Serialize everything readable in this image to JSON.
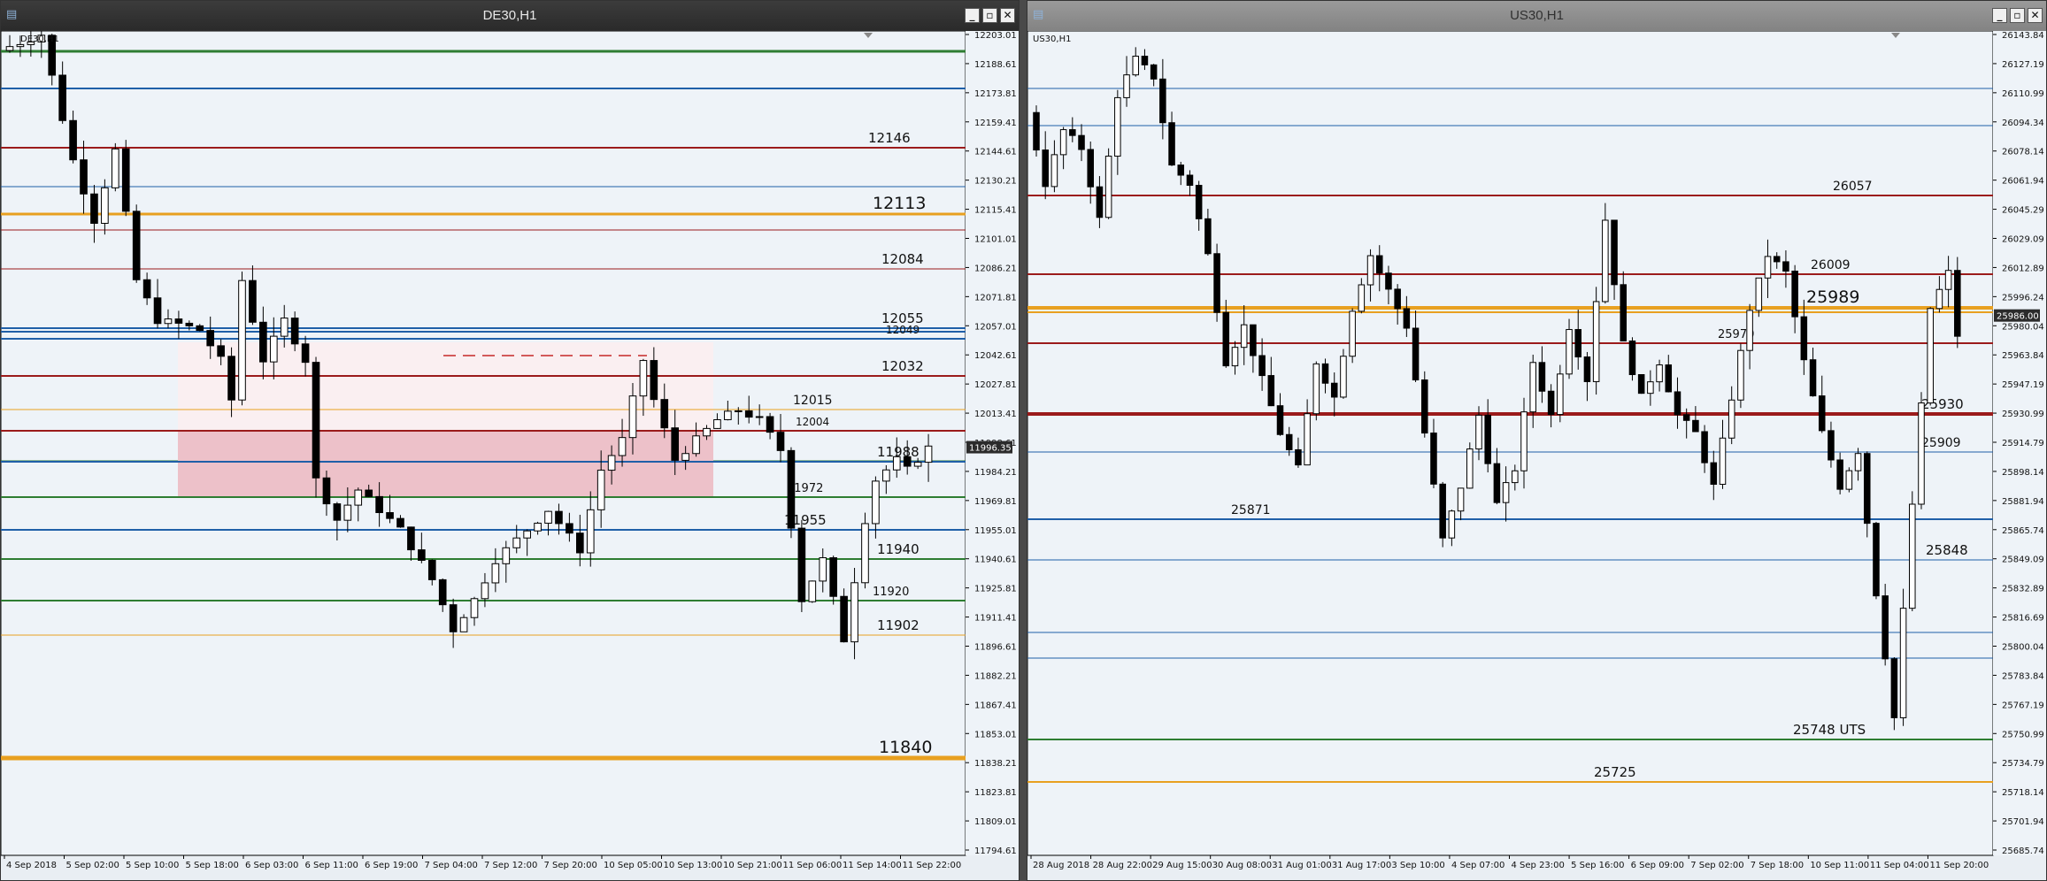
{
  "windows": [
    {
      "title": "DE30,H1",
      "symbol_label": "DE30,H1",
      "price_ticks": [
        "12203.01",
        "12188.61",
        "12173.81",
        "12159.41",
        "12144.61",
        "12130.21",
        "12115.41",
        "12101.01",
        "12086.21",
        "12071.81",
        "12057.01",
        "12042.61",
        "12027.81",
        "12013.41",
        "11998.61",
        "11984.21",
        "11969.81",
        "11955.01",
        "11940.61",
        "11925.81",
        "11911.41",
        "11896.61",
        "11882.21",
        "11867.41",
        "11853.01",
        "11838.21",
        "11823.81",
        "11809.01",
        "11794.61"
      ],
      "current_price": "11996.35",
      "time_ticks": [
        "4 Sep 2018",
        "5 Sep 02:00",
        "5 Sep 10:00",
        "5 Sep 18:00",
        "6 Sep 03:00",
        "6 Sep 11:00",
        "6 Sep 19:00",
        "7 Sep 04:00",
        "7 Sep 12:00",
        "7 Sep 20:00",
        "10 Sep 05:00",
        "10 Sep 13:00",
        "10 Sep 21:00",
        "11 Sep 06:00",
        "11 Sep 14:00",
        "11 Sep 22:00"
      ],
      "levels": [
        {
          "label": "12146",
          "color": "#9b1b1b"
        },
        {
          "label": "12113",
          "color": "#e8a020"
        },
        {
          "label": "12084",
          "color": "#9b1b1b"
        },
        {
          "label": "12055",
          "color": "#1f5fa8"
        },
        {
          "label": "12049",
          "color": "#1f5fa8"
        },
        {
          "label": "12032",
          "color": "#9b1b1b"
        },
        {
          "label": "12015",
          "color": "#e8a020"
        },
        {
          "label": "12004",
          "color": "#9b1b1b"
        },
        {
          "label": "11988",
          "color": "#1f5fa8"
        },
        {
          "label": "11972",
          "color": "#2e7d32"
        },
        {
          "label": "11955",
          "color": "#1f5fa8"
        },
        {
          "label": "11940",
          "color": "#2e7d32"
        },
        {
          "label": "11920",
          "color": "#2e7d32"
        },
        {
          "label": "11902",
          "color": "#e8a020"
        },
        {
          "label": "11840",
          "color": "#e8a020"
        }
      ]
    },
    {
      "title": "US30,H1",
      "symbol_label": "US30,H1",
      "price_ticks": [
        "26143.84",
        "26127.19",
        "26110.99",
        "26094.34",
        "26078.14",
        "26061.94",
        "26045.29",
        "26029.09",
        "26012.89",
        "25996.24",
        "25980.04",
        "25963.84",
        "25947.19",
        "25930.99",
        "25914.79",
        "25898.14",
        "25881.94",
        "25865.74",
        "25849.09",
        "25832.89",
        "25816.69",
        "25800.04",
        "25783.84",
        "25767.19",
        "25750.99",
        "25734.79",
        "25718.14",
        "25701.94",
        "25685.74"
      ],
      "current_price": "25986.00",
      "time_ticks": [
        "28 Aug 2018",
        "28 Aug 22:00",
        "29 Aug 15:00",
        "30 Aug 08:00",
        "31 Aug 01:00",
        "31 Aug 17:00",
        "3 Sep 10:00",
        "4 Sep 07:00",
        "4 Sep 23:00",
        "5 Sep 16:00",
        "6 Sep 09:00",
        "7 Sep 02:00",
        "7 Sep 18:00",
        "10 Sep 11:00",
        "11 Sep 04:00",
        "11 Sep 20:00"
      ],
      "levels": [
        {
          "label": "26057",
          "color": "#9b1b1b"
        },
        {
          "label": "26009",
          "color": "#9b1b1b"
        },
        {
          "label": "25989",
          "color": "#e8a020"
        },
        {
          "label": "25970",
          "color": "#9b1b1b"
        },
        {
          "label": "25930",
          "color": "#9b1b1b"
        },
        {
          "label": "25909",
          "color": "#1f5fa8"
        },
        {
          "label": "25871",
          "color": "#1f5fa8"
        },
        {
          "label": "25848",
          "color": "#1f5fa8"
        },
        {
          "label": "25748 UTS",
          "color": "#2e7d32"
        },
        {
          "label": "25725",
          "color": "#e8a020"
        }
      ]
    }
  ],
  "chart_data": [
    {
      "type": "candlestick",
      "title": "DE30,H1",
      "ylim": [
        11794.61,
        12203.01
      ],
      "x_ticks": [
        "4 Sep 2018",
        "5 Sep 02:00",
        "5 Sep 10:00",
        "5 Sep 18:00",
        "6 Sep 03:00",
        "6 Sep 11:00",
        "6 Sep 19:00",
        "7 Sep 04:00",
        "7 Sep 12:00",
        "7 Sep 20:00",
        "10 Sep 05:00",
        "10 Sep 13:00",
        "10 Sep 21:00",
        "11 Sep 06:00",
        "11 Sep 14:00",
        "11 Sep 22:00"
      ],
      "levels": [
        12146,
        12113,
        12084,
        12055,
        12049,
        12032,
        12015,
        12004,
        11988,
        11972,
        11955,
        11940,
        11920,
        11902,
        11840
      ],
      "path": [
        [
          0,
          12195
        ],
        [
          4,
          12203
        ],
        [
          7,
          12140
        ],
        [
          9,
          12110
        ],
        [
          11,
          12145
        ],
        [
          13,
          12080
        ],
        [
          15,
          12060
        ],
        [
          17,
          12058
        ],
        [
          19,
          12055
        ],
        [
          21,
          12040
        ],
        [
          22,
          12020
        ],
        [
          23,
          12080
        ],
        [
          25,
          12040
        ],
        [
          27,
          12060
        ],
        [
          29,
          12040
        ],
        [
          30,
          11980
        ],
        [
          32,
          11960
        ],
        [
          34,
          11975
        ],
        [
          36,
          11965
        ],
        [
          38,
          11955
        ],
        [
          41,
          11930
        ],
        [
          43,
          11905
        ],
        [
          45,
          11920
        ],
        [
          47,
          11940
        ],
        [
          49,
          11950
        ],
        [
          52,
          11965
        ],
        [
          55,
          11945
        ],
        [
          57,
          11985
        ],
        [
          59,
          12000
        ],
        [
          61,
          12040
        ],
        [
          62,
          12020
        ],
        [
          64,
          11990
        ],
        [
          66,
          12000
        ],
        [
          68,
          12010
        ],
        [
          70,
          12015
        ],
        [
          72,
          12010
        ],
        [
          74,
          11995
        ],
        [
          76,
          11920
        ],
        [
          78,
          11940
        ],
        [
          80,
          11900
        ],
        [
          82,
          11960
        ],
        [
          83,
          11980
        ],
        [
          85,
          11990
        ],
        [
          86,
          11985
        ],
        [
          88,
          11996
        ]
      ]
    },
    {
      "type": "candlestick",
      "title": "US30,H1",
      "ylim": [
        25685.74,
        26143.84
      ],
      "x_ticks": [
        "28 Aug 2018",
        "28 Aug 22:00",
        "29 Aug 15:00",
        "30 Aug 08:00",
        "31 Aug 01:00",
        "31 Aug 17:00",
        "3 Sep 10:00",
        "4 Sep 07:00",
        "4 Sep 23:00",
        "5 Sep 16:00",
        "6 Sep 09:00",
        "7 Sep 02:00",
        "7 Sep 18:00",
        "10 Sep 11:00",
        "11 Sep 04:00",
        "11 Sep 20:00"
      ],
      "levels": [
        26057,
        26009,
        25989,
        25970,
        25930,
        25909,
        25871,
        25848,
        25748,
        25725
      ],
      "path": [
        [
          0,
          26100
        ],
        [
          2,
          26060
        ],
        [
          4,
          26090
        ],
        [
          6,
          26080
        ],
        [
          8,
          26040
        ],
        [
          10,
          26110
        ],
        [
          12,
          26130
        ],
        [
          14,
          26120
        ],
        [
          16,
          26070
        ],
        [
          18,
          26060
        ],
        [
          20,
          26020
        ],
        [
          22,
          25960
        ],
        [
          24,
          25980
        ],
        [
          26,
          25950
        ],
        [
          28,
          25920
        ],
        [
          30,
          25900
        ],
        [
          32,
          25960
        ],
        [
          34,
          25940
        ],
        [
          36,
          25990
        ],
        [
          38,
          26020
        ],
        [
          40,
          26000
        ],
        [
          42,
          25980
        ],
        [
          44,
          25920
        ],
        [
          46,
          25860
        ],
        [
          48,
          25890
        ],
        [
          50,
          25930
        ],
        [
          52,
          25880
        ],
        [
          54,
          25900
        ],
        [
          56,
          25960
        ],
        [
          58,
          25930
        ],
        [
          60,
          25980
        ],
        [
          62,
          25950
        ],
        [
          64,
          26040
        ],
        [
          66,
          25970
        ],
        [
          68,
          25940
        ],
        [
          70,
          25960
        ],
        [
          72,
          25930
        ],
        [
          74,
          25920
        ],
        [
          76,
          25890
        ],
        [
          78,
          25940
        ],
        [
          80,
          25990
        ],
        [
          82,
          26020
        ],
        [
          84,
          26010
        ],
        [
          86,
          25960
        ],
        [
          88,
          25920
        ],
        [
          90,
          25890
        ],
        [
          92,
          25910
        ],
        [
          94,
          25830
        ],
        [
          96,
          25760
        ],
        [
          98,
          25880
        ],
        [
          100,
          25990
        ],
        [
          102,
          26010
        ],
        [
          103,
          25975
        ]
      ]
    }
  ]
}
